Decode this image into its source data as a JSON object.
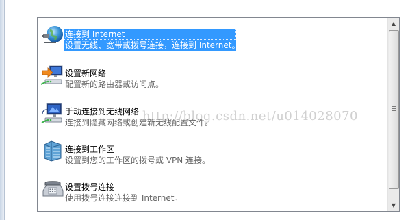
{
  "options": [
    {
      "name": "connect-internet",
      "title": "连接到 Internet",
      "desc": "设置无线、宽带或拨号连接，连接到 Internet。",
      "icon": "globe-icon",
      "selected": true
    },
    {
      "name": "setup-new-network",
      "title": "设置新网络",
      "desc": "配置新的路由器或访问点。",
      "icon": "new-network-icon",
      "selected": false
    },
    {
      "name": "manual-wireless",
      "title": "手动连接到无线网络",
      "desc": "连接到隐藏网络或创建新无线配置文件。",
      "icon": "wireless-monitor-icon",
      "selected": false
    },
    {
      "name": "connect-workplace",
      "title": "连接到工作区",
      "desc": "设置到您的工作区的拨号或 VPN 连接。",
      "icon": "workplace-building-icon",
      "selected": false
    },
    {
      "name": "dialup",
      "title": "设置拨号连接",
      "desc": "使用拨号连接连接到 Internet。",
      "icon": "phone-modem-icon",
      "selected": false
    }
  ],
  "watermark": "http://blog.csdn.net/u014028070",
  "colors": {
    "selection": "#3399ff",
    "desc_text": "#666666",
    "border": "#828790"
  }
}
